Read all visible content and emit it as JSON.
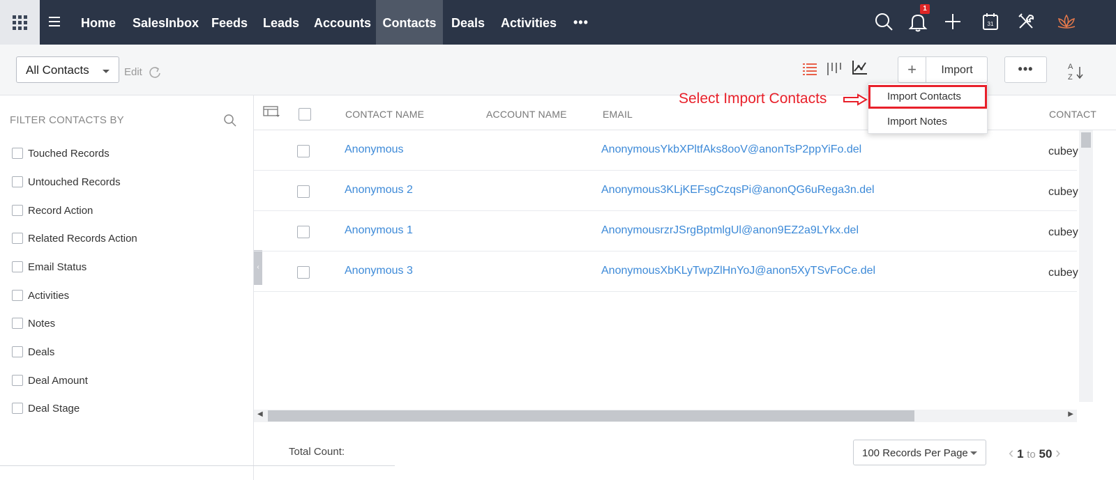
{
  "nav": {
    "items": [
      {
        "label": "Home",
        "active": false
      },
      {
        "label": "SalesInbox",
        "active": false
      },
      {
        "label": "Feeds",
        "active": false
      },
      {
        "label": "Leads",
        "active": false
      },
      {
        "label": "Accounts",
        "active": false
      },
      {
        "label": "Contacts",
        "active": true
      },
      {
        "label": "Deals",
        "active": false
      },
      {
        "label": "Activities",
        "active": false
      }
    ],
    "more_label": "•••",
    "notification_count": "1",
    "calendar_day": "31",
    "icons": [
      "apps-grid-icon",
      "hamburger-icon",
      "search-icon",
      "bell-icon",
      "plus-icon",
      "calendar-icon",
      "tools-icon",
      "lotus-logo-icon"
    ]
  },
  "toolbar": {
    "view_selector": "All Contacts",
    "edit_label": "Edit",
    "import_label": "Import",
    "more_label": "•••",
    "view_icons": [
      "list-view-icon",
      "kanban-view-icon",
      "chart-view-icon"
    ],
    "accent_color": "#e8202a"
  },
  "dropdown": {
    "items": [
      {
        "label": "Import Contacts",
        "highlighted": true
      },
      {
        "label": "Import Notes",
        "highlighted": false
      }
    ]
  },
  "annotation": {
    "text": "Select Import Contacts",
    "color": "#e8202a"
  },
  "sidebar": {
    "heading": "FILTER CONTACTS BY",
    "filters": [
      "Touched Records",
      "Untouched Records",
      "Record Action",
      "Related Records Action",
      "Email Status",
      "Activities",
      "Notes",
      "Deals",
      "Deal Amount",
      "Deal Stage"
    ]
  },
  "table": {
    "columns": [
      "CONTACT NAME",
      "ACCOUNT NAME",
      "EMAIL",
      "CONTACT"
    ],
    "rows": [
      {
        "name": "Anonymous",
        "email": "AnonymousYkbXPltfAks8ooV@anonTsP2ppYiFo.del",
        "contact": "cubey"
      },
      {
        "name": "Anonymous 2",
        "email": "Anonymous3KLjKEFsgCzqsPi@anonQG6uRega3n.del",
        "contact": "cubey"
      },
      {
        "name": "Anonymous 1",
        "email": "AnonymousrzrJSrgBptmlgUl@anon9EZ2a9LYkx.del",
        "contact": "cubey"
      },
      {
        "name": "Anonymous 3",
        "email": "AnonymousXbKLyTwpZlHnYoJ@anon5XyTSvFoCe.del",
        "contact": "cubey"
      }
    ]
  },
  "footer": {
    "total_label": "Total Count:",
    "per_page": "100 Records Per Page",
    "page_from": "1",
    "page_to_label": "to",
    "page_to": "50"
  }
}
